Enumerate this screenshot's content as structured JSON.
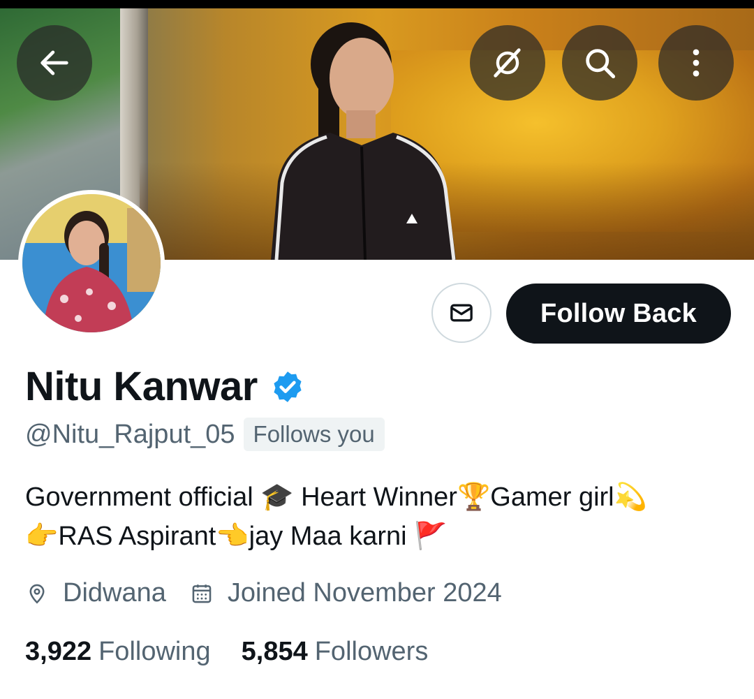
{
  "header": {
    "back_icon": "arrow-left-icon",
    "grok_icon": "grok-icon",
    "search_icon": "search-icon",
    "more_icon": "more-vertical-icon"
  },
  "profile": {
    "name": "Nitu Kanwar",
    "verified": true,
    "verified_color": "#1d9bf0",
    "handle": "@Nitu_Rajput_05",
    "follows_you": "Follows you",
    "bio_line1": "Government official 🎓 Heart Winner🏆Gamer girl💫",
    "bio_line2": "👉RAS Aspirant👈jay Maa karni 🚩",
    "location": "Didwana",
    "joined": "Joined November 2024",
    "following_count": "3,922",
    "following_label": "Following",
    "followers_count": "5,854",
    "followers_label": "Followers"
  },
  "actions": {
    "message_icon": "envelope-icon",
    "follow_label": "Follow Back"
  },
  "colors": {
    "primary_text": "#0f1419",
    "secondary_text": "#536471",
    "button_dark": "#0f1419"
  }
}
